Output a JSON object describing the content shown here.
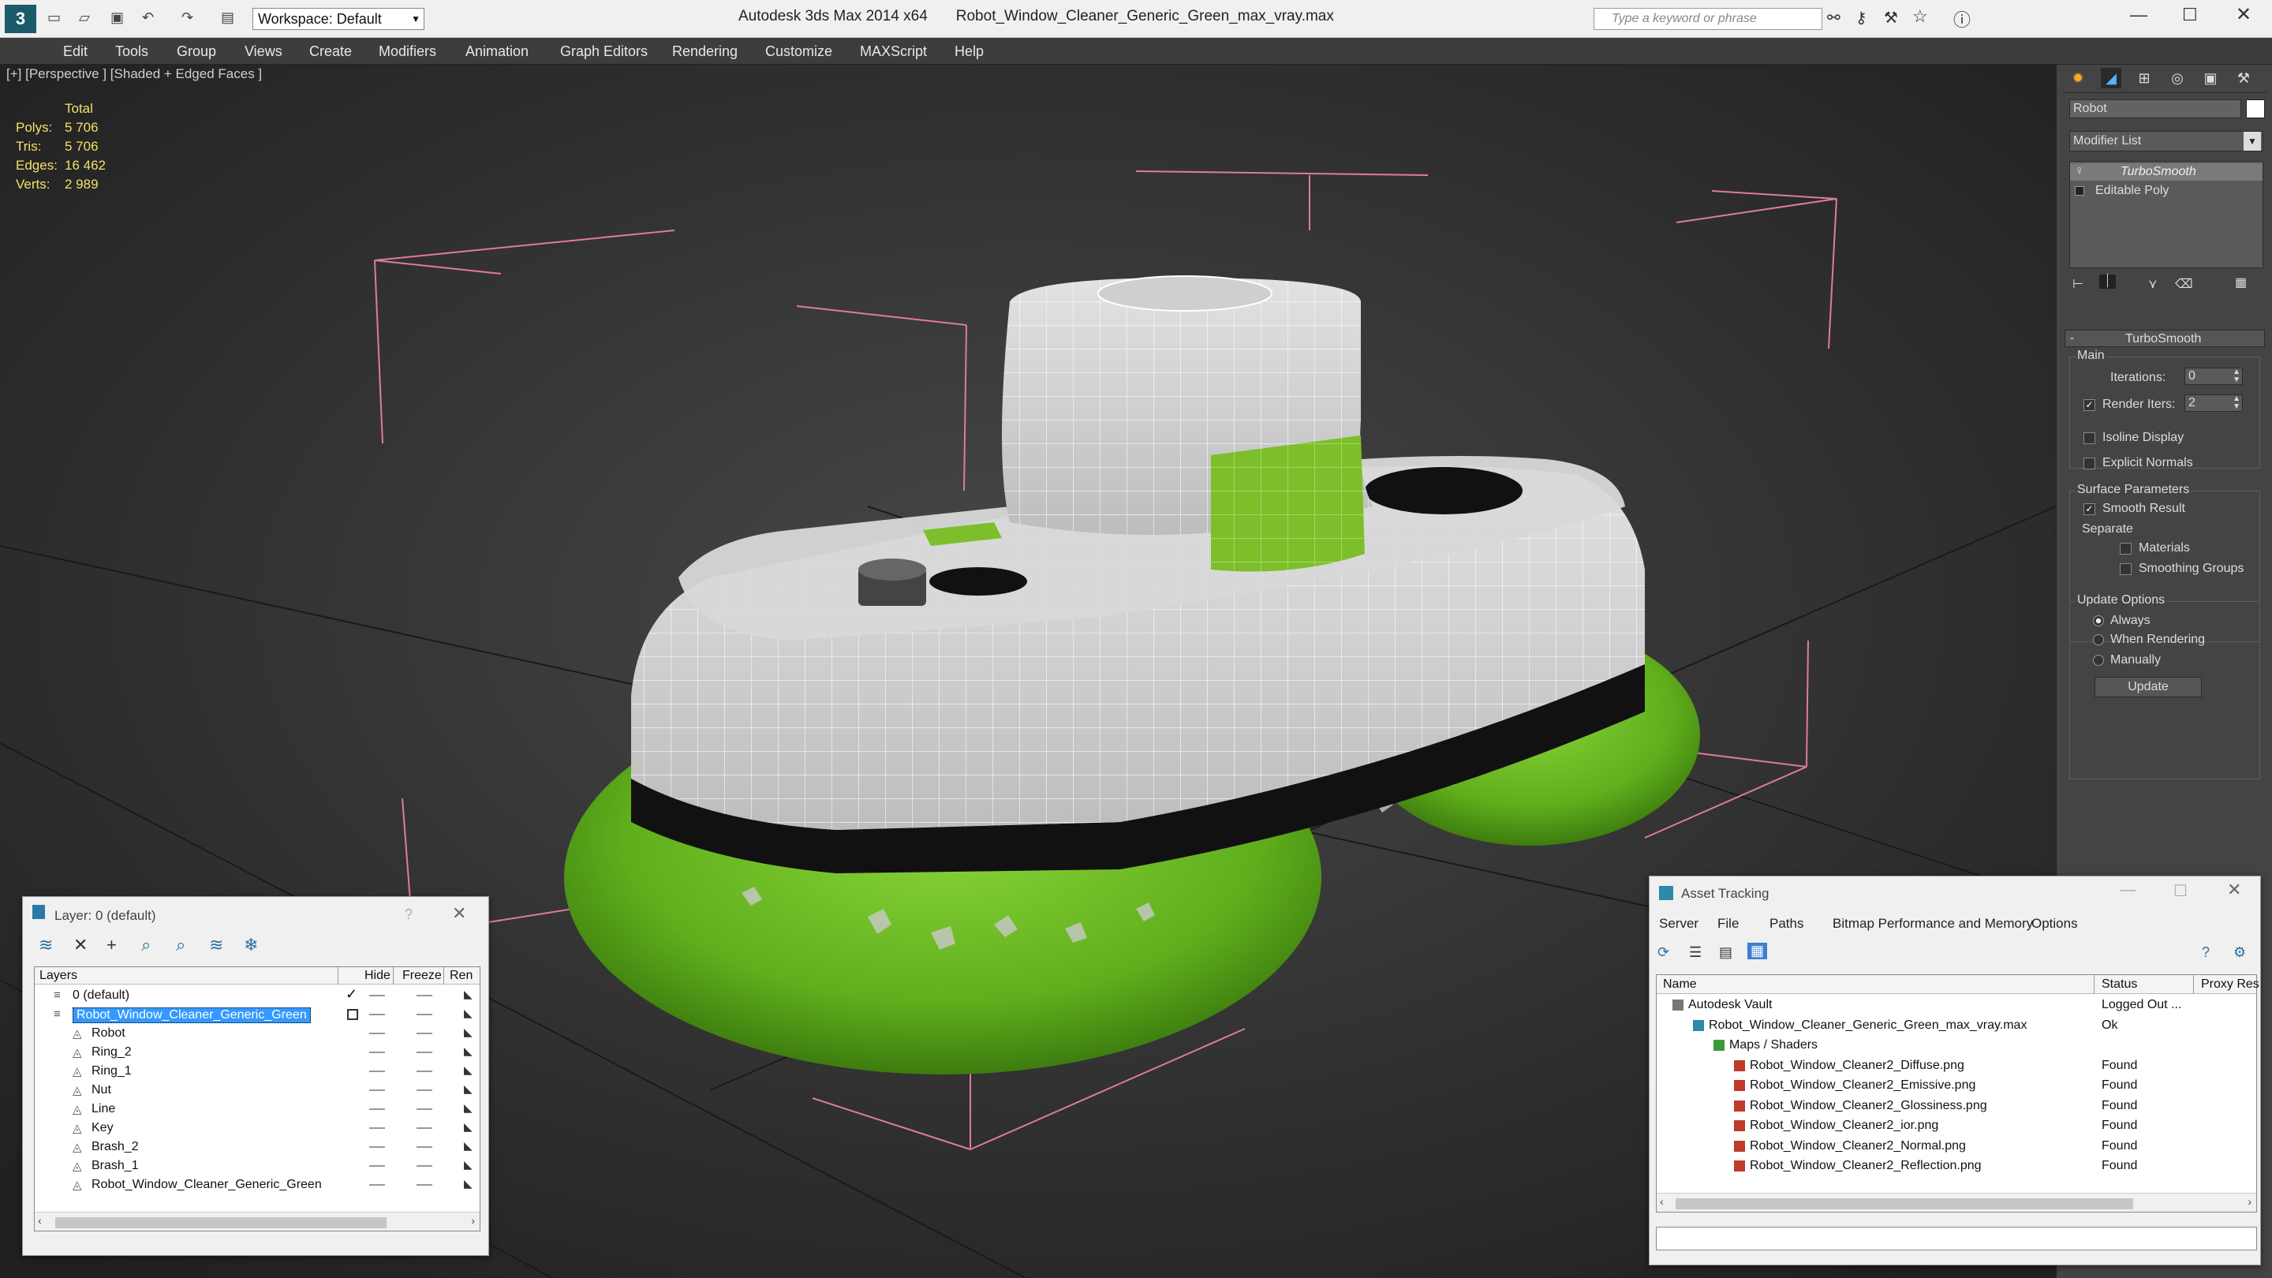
{
  "app": {
    "title": "Autodesk 3ds Max  2014 x64",
    "file": "Robot_Window_Cleaner_Generic_Green_max_vray.max",
    "workspace": "Workspace: Default",
    "search_placeholder": "Type a keyword or phrase"
  },
  "menu": [
    "Edit",
    "Tools",
    "Group",
    "Views",
    "Create",
    "Modifiers",
    "Animation",
    "Graph Editors",
    "Rendering",
    "Customize",
    "MAXScript",
    "Help"
  ],
  "viewport": {
    "label": "[+] [Perspective ] [Shaded + Edged Faces ]",
    "stats_header": "Total",
    "stats": [
      {
        "label": "Polys:",
        "value": "5 706"
      },
      {
        "label": "Tris:",
        "value": "5 706"
      },
      {
        "label": "Edges:",
        "value": "16 462"
      },
      {
        "label": "Verts:",
        "value": "2 989"
      }
    ]
  },
  "command_panel": {
    "object_name": "Robot",
    "modifier_list": "Modifier List",
    "stack": [
      "TurboSmooth",
      "Editable Poly"
    ],
    "rollout_title": "TurboSmooth",
    "main_label": "Main",
    "iterations_label": "Iterations:",
    "iterations_value": "0",
    "render_iters_label": "Render Iters:",
    "render_iters_value": "2",
    "isoline": "Isoline Display",
    "explicit": "Explicit Normals",
    "surface_params": "Surface Parameters",
    "smooth_result": "Smooth Result",
    "separate": "Separate",
    "materials": "Materials",
    "smoothing_groups": "Smoothing Groups",
    "update_options": "Update Options",
    "always": "Always",
    "when_rendering": "When Rendering",
    "manually": "Manually",
    "update_button": "Update"
  },
  "layer_window": {
    "title": "Layer: 0 (default)",
    "help": "?",
    "columns": [
      "Layers",
      "Hide",
      "Freeze",
      "Ren"
    ],
    "rows": [
      {
        "name": "0 (default)",
        "indent": 1
      },
      {
        "name": "Robot_Window_Cleaner_Generic_Green",
        "indent": 1
      },
      {
        "name": "Robot",
        "indent": 2
      },
      {
        "name": "Ring_2",
        "indent": 2
      },
      {
        "name": "Ring_1",
        "indent": 2
      },
      {
        "name": "Nut",
        "indent": 2
      },
      {
        "name": "Line",
        "indent": 2
      },
      {
        "name": "Key",
        "indent": 2
      },
      {
        "name": "Brash_2",
        "indent": 2
      },
      {
        "name": "Brash_1",
        "indent": 2
      },
      {
        "name": "Robot_Window_Cleaner_Generic_Green",
        "indent": 2
      }
    ]
  },
  "asset_window": {
    "title": "Asset Tracking",
    "menu": [
      "Server",
      "File",
      "Paths",
      "Bitmap Performance and Memory",
      "Options"
    ],
    "columns": [
      "Name",
      "Status",
      "Proxy Res"
    ],
    "rows": [
      {
        "name": "Autodesk Vault",
        "status": "Logged Out ...",
        "indent": 0
      },
      {
        "name": "Robot_Window_Cleaner_Generic_Green_max_vray.max",
        "status": "Ok",
        "indent": 1
      },
      {
        "name": "Maps / Shaders",
        "status": "",
        "indent": 2
      },
      {
        "name": "Robot_Window_Cleaner2_Diffuse.png",
        "status": "Found",
        "indent": 3
      },
      {
        "name": "Robot_Window_Cleaner2_Emissive.png",
        "status": "Found",
        "indent": 3
      },
      {
        "name": "Robot_Window_Cleaner2_Glossiness.png",
        "status": "Found",
        "indent": 3
      },
      {
        "name": "Robot_Window_Cleaner2_ior.png",
        "status": "Found",
        "indent": 3
      },
      {
        "name": "Robot_Window_Cleaner2_Normal.png",
        "status": "Found",
        "indent": 3
      },
      {
        "name": "Robot_Window_Cleaner2_Reflection.png",
        "status": "Found",
        "indent": 3
      }
    ]
  },
  "colors": {
    "brush_green": "#5fae1c",
    "selection_blue": "#3399ff",
    "stats_yellow": "#f2e06a"
  }
}
